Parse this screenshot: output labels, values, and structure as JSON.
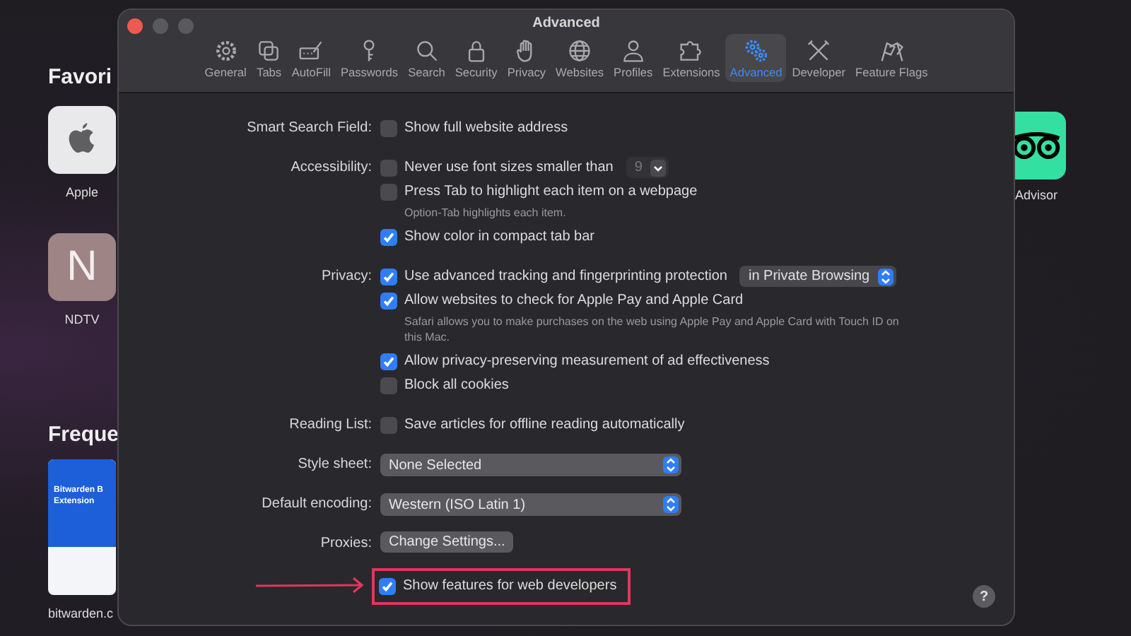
{
  "background": {
    "favorites": {
      "heading": "Favori",
      "tiles": [
        {
          "kind": "apple",
          "label": "Apple"
        },
        {
          "kind": "letter",
          "letter": "N",
          "label": "NDTV"
        }
      ]
    },
    "frequent": {
      "heading": "Freque",
      "thumbnail": {
        "lines": [
          "Bitwarden B",
          "Extension"
        ],
        "label": "bitwarden.c"
      }
    },
    "right_tile": {
      "kind": "owl",
      "label": "Advisor"
    }
  },
  "window": {
    "title": "Advanced"
  },
  "tabs": [
    {
      "label": "General",
      "selected": false
    },
    {
      "label": "Tabs",
      "selected": false
    },
    {
      "label": "AutoFill",
      "selected": false
    },
    {
      "label": "Passwords",
      "selected": false
    },
    {
      "label": "Search",
      "selected": false
    },
    {
      "label": "Security",
      "selected": false
    },
    {
      "label": "Privacy",
      "selected": false
    },
    {
      "label": "Websites",
      "selected": false
    },
    {
      "label": "Profiles",
      "selected": false
    },
    {
      "label": "Extensions",
      "selected": false
    },
    {
      "label": "Advanced",
      "selected": true
    },
    {
      "label": "Developer",
      "selected": false
    },
    {
      "label": "Feature Flags",
      "selected": false
    }
  ],
  "sections": [
    {
      "label": "Smart Search Field:",
      "items": [
        {
          "kind": "checkbox",
          "label": "Show full website address",
          "checked": false
        }
      ]
    },
    {
      "label": "Accessibility:",
      "items": [
        {
          "kind": "checkbox",
          "label": "Never use font sizes smaller than",
          "checked": false,
          "popup": {
            "value": "9",
            "disabled": true
          }
        },
        {
          "kind": "checkbox",
          "label": "Press Tab to highlight each item on a webpage",
          "checked": false
        },
        {
          "kind": "note",
          "text": "Option-Tab highlights each item."
        },
        {
          "kind": "checkbox",
          "label": "Show color in compact tab bar",
          "checked": true
        }
      ]
    },
    {
      "label": "Privacy:",
      "items": [
        {
          "kind": "checkbox",
          "label": "Use advanced tracking and fingerprinting protection",
          "checked": true,
          "popup": {
            "value": "in Private Browsing",
            "disabled": false
          }
        },
        {
          "kind": "checkbox",
          "label": "Allow websites to check for Apple Pay and Apple Card",
          "checked": true
        },
        {
          "kind": "note",
          "text": "Safari allows you to make purchases on the web using Apple Pay and Apple Card with Touch ID on this Mac."
        },
        {
          "kind": "checkbox",
          "label": "Allow privacy-preserving measurement of ad effectiveness",
          "checked": true
        },
        {
          "kind": "checkbox",
          "label": "Block all cookies",
          "checked": false
        }
      ]
    },
    {
      "label": "Reading List:",
      "items": [
        {
          "kind": "checkbox",
          "label": "Save articles for offline reading automatically",
          "checked": false
        }
      ]
    },
    {
      "label": "Style sheet:",
      "items": [
        {
          "kind": "select",
          "value": "None Selected"
        }
      ]
    },
    {
      "label": "Default encoding:",
      "items": [
        {
          "kind": "select",
          "value": "Western (ISO Latin 1)"
        }
      ]
    },
    {
      "label": "Proxies:",
      "items": [
        {
          "kind": "button",
          "label": "Change Settings..."
        }
      ]
    },
    {
      "items": [
        {
          "kind": "checkbox",
          "label": "Show features for web developers",
          "checked": true,
          "highlighted": true
        }
      ]
    }
  ],
  "help_button": "?"
}
